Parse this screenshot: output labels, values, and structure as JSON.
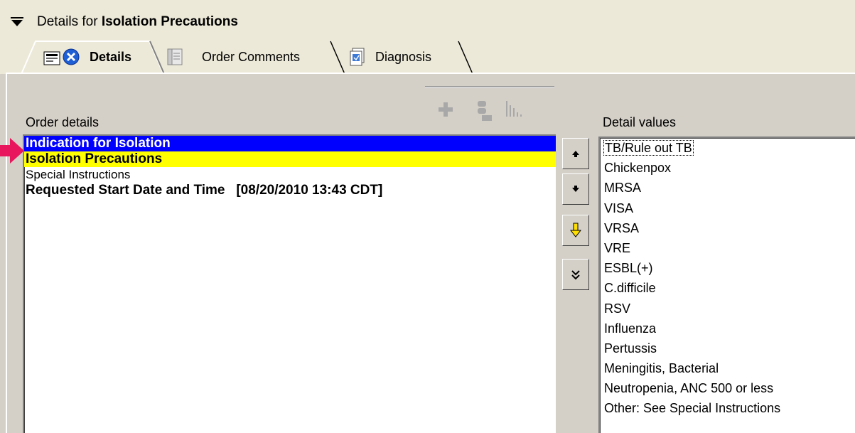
{
  "header": {
    "prefix": "Details for ",
    "title": "Isolation Precautions"
  },
  "tabs": [
    {
      "label": "Details",
      "active": true
    },
    {
      "label": "Order Comments",
      "active": false
    },
    {
      "label": "Diagnosis",
      "active": false
    }
  ],
  "order_details": {
    "label": "Order details",
    "rows": [
      {
        "text": "Indication for Isolation",
        "style": "blue"
      },
      {
        "text": "Isolation Precautions",
        "style": "yellow"
      },
      {
        "text": "Special Instructions",
        "style": "plain"
      },
      {
        "text": "Requested Start Date and Time   [08/20/2010 13:43 CDT]",
        "style": "bold"
      }
    ]
  },
  "detail_values": {
    "label": "Detail values",
    "items": [
      "TB/Rule out TB",
      "Chickenpox",
      "MRSA",
      "VISA",
      "VRSA",
      "VRE",
      "ESBL(+)",
      "C.difficile",
      "RSV",
      "Influenza",
      "Pertussis",
      "Meningitis, Bacterial",
      "Neutropenia, ANC 500 or less",
      "Other:  See Special Instructions"
    ]
  },
  "colors": {
    "selected_row": "#0000ff",
    "highlight_row": "#ffff00",
    "arrow": "#e8175d"
  }
}
